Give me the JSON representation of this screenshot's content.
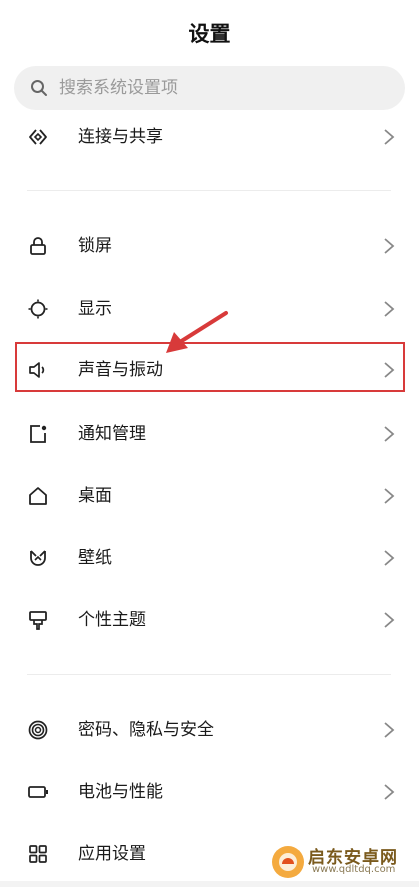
{
  "header": {
    "title": "设置"
  },
  "search": {
    "placeholder": "搜索系统设置项",
    "icon": "search-icon"
  },
  "rows": [
    {
      "label": "连接与共享",
      "icon": "share-connect-icon"
    },
    {
      "label": "锁屏",
      "icon": "lock-icon"
    },
    {
      "label": "显示",
      "icon": "brightness-icon"
    },
    {
      "label": "声音与振动",
      "icon": "speaker-icon"
    },
    {
      "label": "通知管理",
      "icon": "notification-icon"
    },
    {
      "label": "桌面",
      "icon": "home-icon"
    },
    {
      "label": "壁纸",
      "icon": "wallpaper-icon"
    },
    {
      "label": "个性主题",
      "icon": "theme-brush-icon"
    },
    {
      "label": "密码、隐私与安全",
      "icon": "fingerprint-icon"
    },
    {
      "label": "电池与性能",
      "icon": "battery-icon"
    },
    {
      "label": "应用设置",
      "icon": "apps-grid-icon"
    }
  ],
  "annotation": {
    "highlight_color": "#d83a3a",
    "highlighted_row": "声音与振动"
  },
  "watermark": {
    "text": "启东安卓网",
    "url": "www.qdltdq.com"
  },
  "colors": {
    "background": "#ffffff",
    "search_bg": "#f0f0f0",
    "text": "#1a1a1a",
    "placeholder": "#9a9a9a",
    "chevron": "#888888"
  }
}
